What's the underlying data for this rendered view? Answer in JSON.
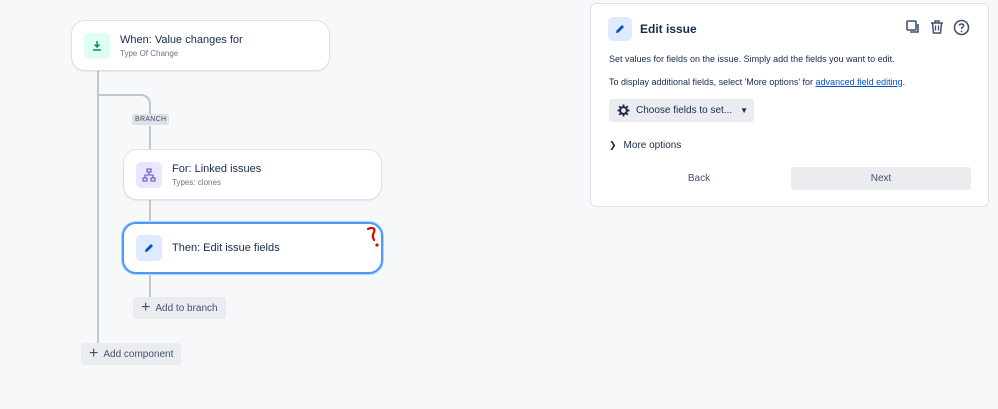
{
  "flow": {
    "trigger": {
      "title": "When: Value changes for",
      "subtitle": "Type Of Change",
      "icon": "download-icon"
    },
    "branch_tag": "BRANCH",
    "branch": {
      "title": "For: Linked issues",
      "subtitle": "Types: clones",
      "icon": "hierarchy-icon"
    },
    "action": {
      "title": "Then: Edit issue fields",
      "icon": "pencil-icon"
    },
    "add_to_branch": "Add to branch",
    "add_component": "Add component"
  },
  "panel": {
    "title": "Edit issue",
    "description_1": "Set values for fields on the issue. Simply add the fields you want to edit.",
    "description_2_prefix": "To display additional fields, select 'More options' for ",
    "description_2_link": "advanced field editing",
    "description_2_suffix": ".",
    "choose_fields_label": "Choose fields to set...",
    "more_options_label": "More options",
    "back_label": "Back",
    "next_label": "Next"
  },
  "colors": {
    "accent": "#0052cc",
    "selected_border": "#4c9aff",
    "annotation": "#e60000"
  }
}
